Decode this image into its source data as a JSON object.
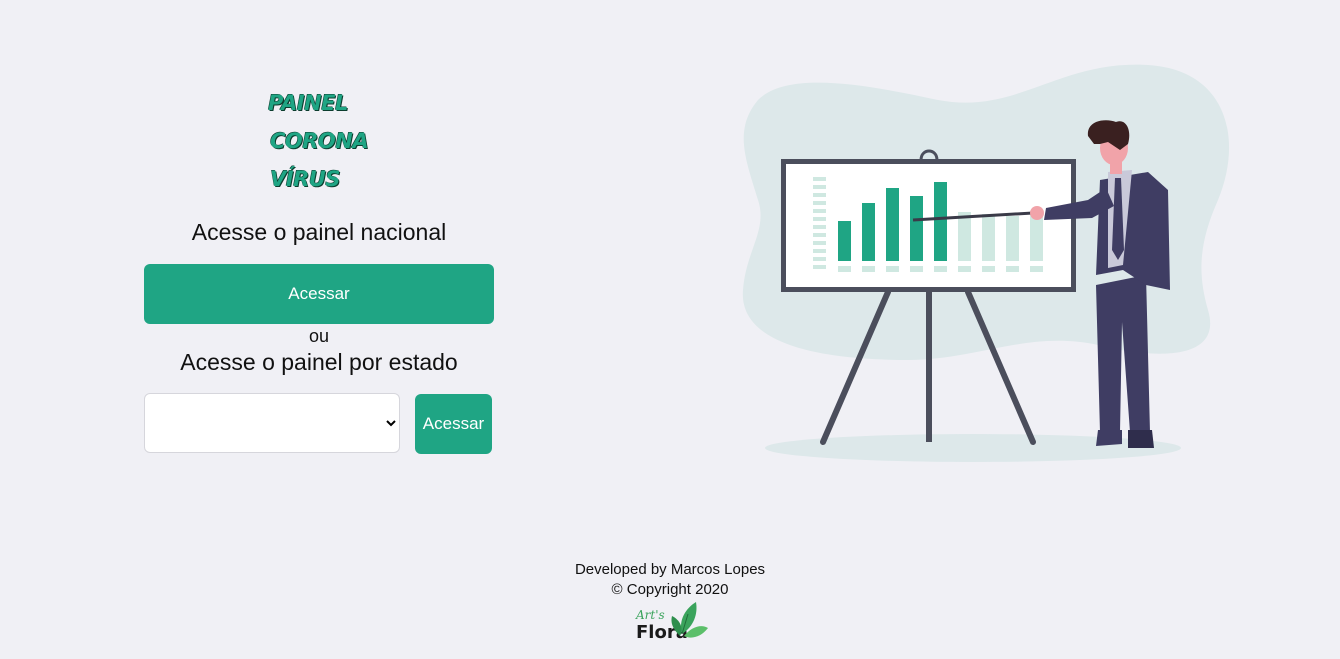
{
  "logo": {
    "line1": "PAINEL",
    "line2": "CORONA",
    "line3": "VÍRUS"
  },
  "nacional": {
    "heading": "Acesse o painel nacional",
    "button_label": "Acessar"
  },
  "separator": "ou",
  "estado": {
    "heading": "Acesse o painel por estado",
    "selected_value": "",
    "button_label": "Acessar"
  },
  "illustration": {
    "icon": "presentation-chart-illustration",
    "colors": {
      "accent": "#1fa584",
      "faded": "#cfe8e1",
      "blob": "#dde8ea",
      "frame": "#4b4e5c",
      "suit": "#3f3d63"
    }
  },
  "footer": {
    "developed_by": "Developed by Marcos Lopes",
    "copyright": "© Copyright 2020",
    "brand_script": "Art's",
    "brand_word": "Flora"
  },
  "colors": {
    "background": "#f0f0f5",
    "primary": "#1fa584",
    "text": "#111111"
  }
}
